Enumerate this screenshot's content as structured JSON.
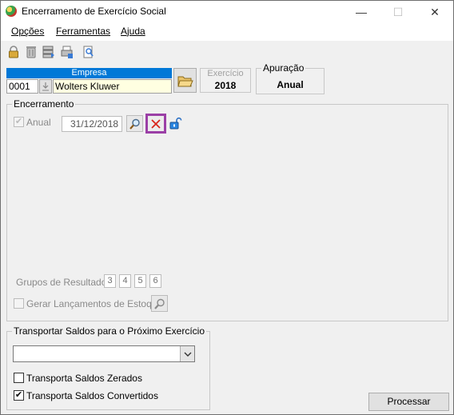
{
  "window": {
    "title": "Encerramento de Exercício Social",
    "minimize_glyph": "—",
    "maximize_glyph": "☐",
    "close_glyph": "✕"
  },
  "menu": {
    "items": [
      "Opções",
      "Ferramentas",
      "Ajuda"
    ]
  },
  "toolbar": {
    "icons": [
      "padlock-icon",
      "trash-icon",
      "server-stack-icon",
      "print-preview-icon",
      "search-document-icon"
    ]
  },
  "empresa": {
    "header": "Empresa",
    "code": "0001",
    "name": "Wolters Kluwer"
  },
  "exercicio": {
    "label": "Exercício",
    "value": "2018"
  },
  "apuracao": {
    "title": "Apuração",
    "value": "Anual"
  },
  "encerramento": {
    "title": "Encerramento",
    "anual_label": "Anual",
    "anual_checked": true,
    "date": "31/12/2018",
    "grupos_label": "Grupos de Resultado:",
    "grupos": [
      "3",
      "4",
      "5",
      "6"
    ],
    "estoque_label": "Gerar Lançamentos de Estoque"
  },
  "transportar": {
    "title": "Transportar Saldos para o Próximo Exercício",
    "combo_value": "",
    "zerados_label": "Transporta Saldos Zerados",
    "zerados_checked": false,
    "convertidos_label": "Transporta Saldos Convertidos",
    "convertidos_checked": true
  },
  "actions": {
    "processar_label": "Processar"
  },
  "colors": {
    "accent": "#0078d7",
    "highlight_border": "#9b3fa6",
    "cancel_red": "#d9261c",
    "name_field_bg": "#ffffe1"
  }
}
